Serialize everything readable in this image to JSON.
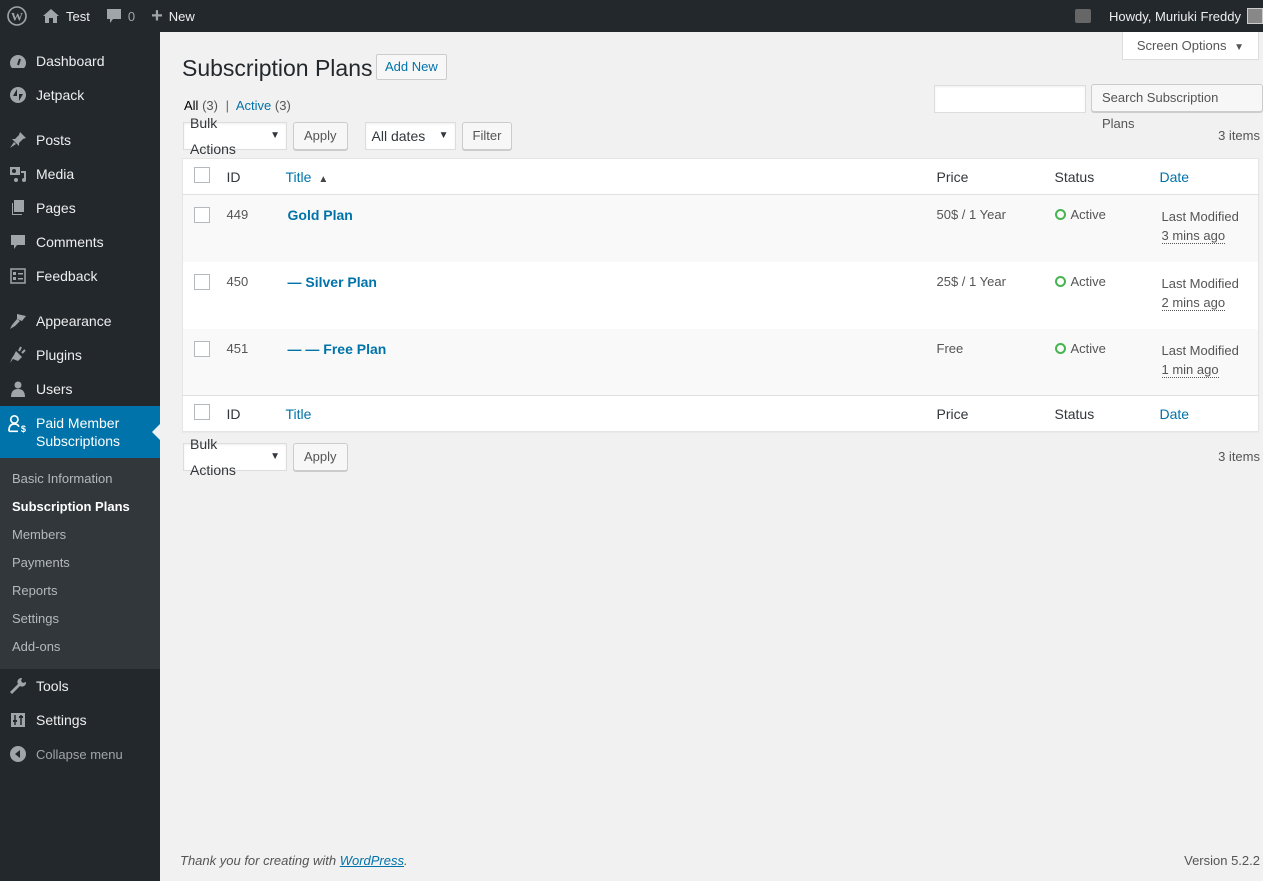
{
  "adminbar": {
    "site_name": "Test",
    "comments_count": "0",
    "new_label": "New",
    "howdy": "Howdy, Muriuki Freddy"
  },
  "sidebar": {
    "items": [
      {
        "label": "Dashboard",
        "icon": "dashboard-icon"
      },
      {
        "label": "Jetpack",
        "icon": "jetpack-icon"
      },
      {
        "label": "Posts",
        "icon": "pin-icon"
      },
      {
        "label": "Media",
        "icon": "media-icon"
      },
      {
        "label": "Pages",
        "icon": "pages-icon"
      },
      {
        "label": "Comments",
        "icon": "comment-icon"
      },
      {
        "label": "Feedback",
        "icon": "feedback-icon"
      },
      {
        "label": "Appearance",
        "icon": "paintbrush-icon"
      },
      {
        "label": "Plugins",
        "icon": "plugin-icon"
      },
      {
        "label": "Users",
        "icon": "user-icon"
      },
      {
        "label": "Paid Member Subscriptions",
        "icon": "member-dollar-icon"
      }
    ],
    "submenu": [
      "Basic Information",
      "Subscription Plans",
      "Members",
      "Payments",
      "Reports",
      "Settings",
      "Add-ons"
    ],
    "bottom": [
      {
        "label": "Tools",
        "icon": "wrench-icon"
      },
      {
        "label": "Settings",
        "icon": "settings-sliders-icon"
      }
    ],
    "collapse": "Collapse menu"
  },
  "page": {
    "screen_options": "Screen Options",
    "title": "Subscription Plans",
    "add_new": "Add New",
    "filters": {
      "all": "All",
      "all_count": "(3)",
      "sep": "|",
      "active": "Active",
      "active_count": "(3)"
    },
    "bulk_actions": "Bulk Actions",
    "apply": "Apply",
    "all_dates": "All dates",
    "filter": "Filter",
    "search_button": "Search Subscription Plans",
    "search_value": "",
    "items_count": "3 items"
  },
  "table": {
    "columns": {
      "id": "ID",
      "title": "Title",
      "price": "Price",
      "status": "Status",
      "date": "Date"
    },
    "rows": [
      {
        "id": "449",
        "title": "Gold Plan",
        "price": "50$ / 1 Year",
        "status": "Active",
        "date_label": "Last Modified",
        "date_ago": "3 mins ago"
      },
      {
        "id": "450",
        "title": "— Silver Plan",
        "price": "25$ / 1 Year",
        "status": "Active",
        "date_label": "Last Modified",
        "date_ago": "2 mins ago"
      },
      {
        "id": "451",
        "title": "— — Free Plan",
        "price": "Free",
        "status": "Active",
        "date_label": "Last Modified",
        "date_ago": "1 min ago"
      }
    ]
  },
  "footer": {
    "thanks": "Thank you for creating with ",
    "wp_link": "WordPress",
    "period": ".",
    "version": "Version 5.2.2"
  }
}
